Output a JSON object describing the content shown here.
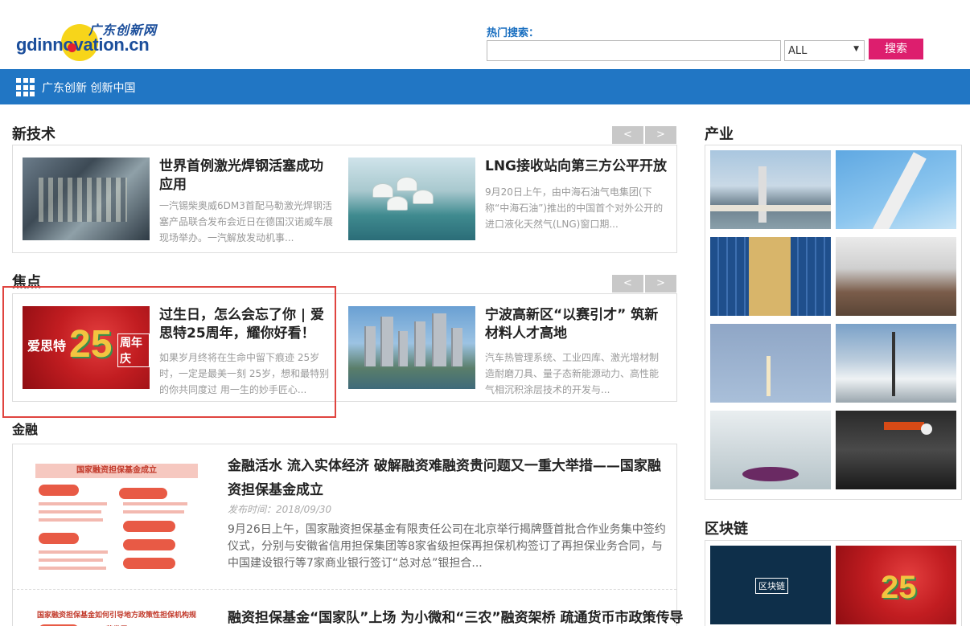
{
  "header": {
    "logo_cn": "广东创新网",
    "logo_en": "gdinnovation.cn",
    "hot_search_label": "热门搜索：",
    "search_value": "",
    "search_select": "ALL",
    "search_button": "搜索"
  },
  "navbar": {
    "text": "广东创新 创新中国"
  },
  "xinjishu": {
    "title": "新技术",
    "prev": "<",
    "next": ">",
    "items": [
      {
        "title": "世界首例激光焊钢活塞成功应用",
        "desc": "一汽锡柴奥威6DM3首配马勒激光焊钢活塞产品联合发布会近日在德国汉诺威车展现场举办。一汽解放发动机事..."
      },
      {
        "title": "LNG接收站向第三方公平开放",
        "desc": "9月20日上午，由中海石油气电集团(下称“中海石油”)推出的中国首个对外公开的进口液化天然气(LNG)窗口期..."
      }
    ]
  },
  "jiaodian": {
    "title": "焦点",
    "prev": "<",
    "next": ">",
    "items": [
      {
        "title": "过生日，怎么会忘了你 | 爱思特25周年，耀你好看！",
        "desc": "如果岁月终将在生命中留下痕迹 25岁时，一定是最美一刻 25岁，想和最特别的你共同度过 用一生的妙手匠心...",
        "img_text_left": "爱思特",
        "img_text_num": "25",
        "img_text_right": "周年庆"
      },
      {
        "title": "宁波高新区“以赛引才” 筑新材料人才高地",
        "desc": "汽车热管理系统、工业四库、激光增材制造耐磨刀具、量子态新能源动力、高性能气相沉积涂层技术的开发与..."
      }
    ]
  },
  "jinrong": {
    "title": "金融",
    "items": [
      {
        "title": "金融活水 流入实体经济 破解融资难融资贵问题又一重大举措——国家融资担保基金成立",
        "date": "发布时间：2018/09/30",
        "desc": "9月26日上午，国家融资担保基金有限责任公司在北京举行揭牌暨首批合作业务集中签约仪式，分别与安徽省信用担保集团等8家省级担保再担保机构签订了再担保业务合同，与中国建设银行等7家商业银行签订“总对总”银担合...",
        "img_head": "国家融资担保基金成立"
      },
      {
        "title": "融资担保基金“国家队”上场 为小微和“三农”融资架桥 疏通货币市政策传导",
        "img_head": "国家融资担保基金如何引导地方政策性担保机构规范发展"
      }
    ]
  },
  "sidebar": {
    "chanye_title": "产业",
    "qukuailian_title": "区块链",
    "blockchain_label": "区块链",
    "thumb_25": "25"
  }
}
